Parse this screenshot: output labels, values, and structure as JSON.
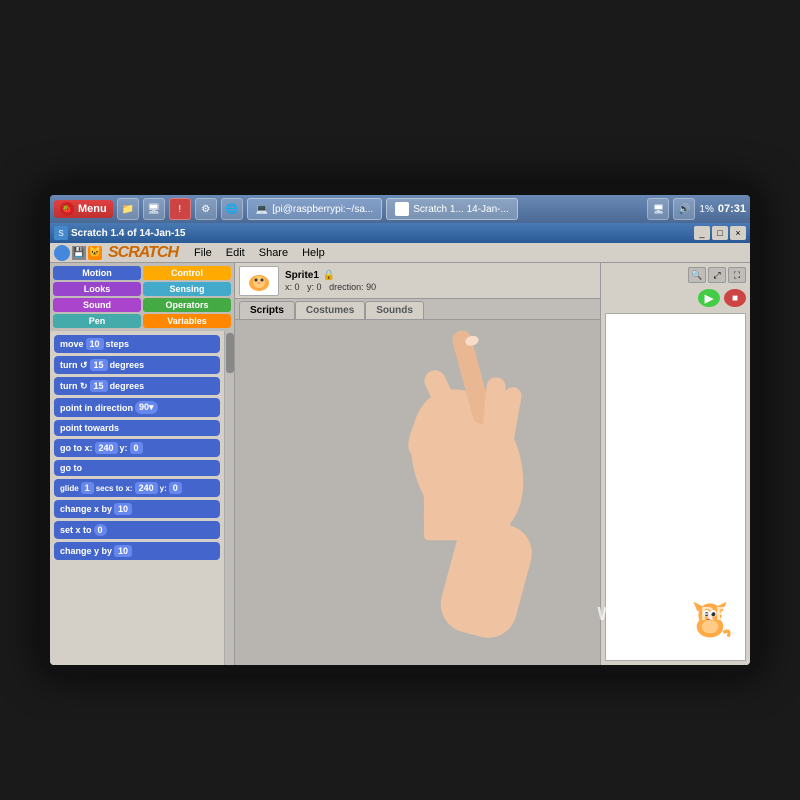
{
  "monitor": {
    "background": "#111111"
  },
  "taskbar": {
    "menu_label": "Menu",
    "window1_label": "[pi@raspberrypi:~/sa...",
    "window2_label": "Scratch 1... 14-Jan-...",
    "battery": "1%",
    "time": "07:31"
  },
  "scratch_window": {
    "title": "Scratch 1.4 of 14-Jan-15",
    "menu_items": [
      "File",
      "Edit",
      "Share",
      "Help"
    ],
    "logo": "SCRATCH"
  },
  "sprite": {
    "name": "Sprite1",
    "x": "0",
    "y": "0",
    "direction": "90"
  },
  "tabs": {
    "scripts": "Scripts",
    "costumes": "Costumes",
    "sounds": "Sounds"
  },
  "categories": [
    {
      "label": "Motion",
      "class": "cat-motion"
    },
    {
      "label": "Control",
      "class": "cat-control"
    },
    {
      "label": "Looks",
      "class": "cat-looks"
    },
    {
      "label": "Sensing",
      "class": "cat-sensing"
    },
    {
      "label": "Sound",
      "class": "cat-sound"
    },
    {
      "label": "Operators",
      "class": "cat-operators"
    },
    {
      "label": "Pen",
      "class": "cat-pen"
    },
    {
      "label": "Variables",
      "class": "cat-variables"
    }
  ],
  "blocks": [
    {
      "label": "move 10 steps",
      "type": "motion"
    },
    {
      "label": "turn ↺ 15 degrees",
      "type": "motion"
    },
    {
      "label": "turn ↻ 15 degrees",
      "type": "motion"
    },
    {
      "label": "point in direction 90▾",
      "type": "motion"
    },
    {
      "label": "point towards",
      "type": "motion"
    },
    {
      "label": "go to x: 240 y: 0",
      "type": "motion"
    },
    {
      "label": "go to",
      "type": "motion"
    },
    {
      "label": "glide 1 secs to x: 240 y: 0",
      "type": "motion"
    },
    {
      "label": "change x by 10",
      "type": "motion"
    },
    {
      "label": "set x to 0",
      "type": "motion"
    },
    {
      "label": "change y by 10",
      "type": "motion"
    }
  ],
  "stage_controls": {
    "go_label": "▶",
    "stop_label": "■"
  },
  "watermark": "WAVESHARE"
}
